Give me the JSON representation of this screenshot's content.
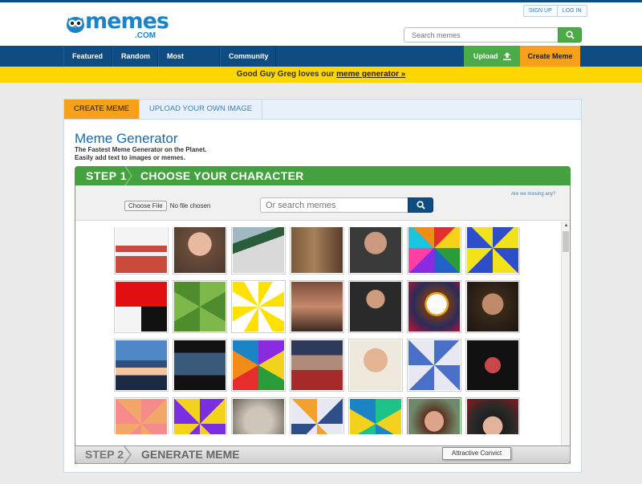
{
  "header": {
    "logo_text": "memes",
    "logo_suffix": ".COM",
    "sign_up": "SIGN UP",
    "log_in": "LOG IN",
    "search_placeholder": "Search memes"
  },
  "nav": {
    "items": [
      "Featured",
      "Random",
      "Most Popular",
      "Community"
    ],
    "upload_label": "Upload",
    "create_label": "Create Meme"
  },
  "promo": {
    "text": "Good Guy Greg loves our ",
    "link": "meme generator »"
  },
  "tabs": [
    "CREATE MEME",
    "UPLOAD YOUR OWN IMAGE"
  ],
  "generator": {
    "title": "Meme Generator",
    "subtitle1": "The Fastest Meme Generator on the Planet.",
    "subtitle2": "Easily add text to images or memes."
  },
  "step1": {
    "num": "STEP 1",
    "label": "CHOOSE YOUR CHARACTER"
  },
  "toolbar": {
    "choose_file": "Choose File",
    "no_file": "No file chosen",
    "search_placeholder": "Or search memes",
    "missing_link": "Are we missing any?"
  },
  "step2": {
    "num": "STEP 2",
    "label": "GENERATE MEME"
  },
  "tooltip": "Attractive Convict",
  "colors": {
    "brand_blue": "#0f4c81",
    "logo_blue": "#1b84c8",
    "green": "#4caa48",
    "orange": "#f7a11a",
    "yellow": "#ffd600"
  }
}
